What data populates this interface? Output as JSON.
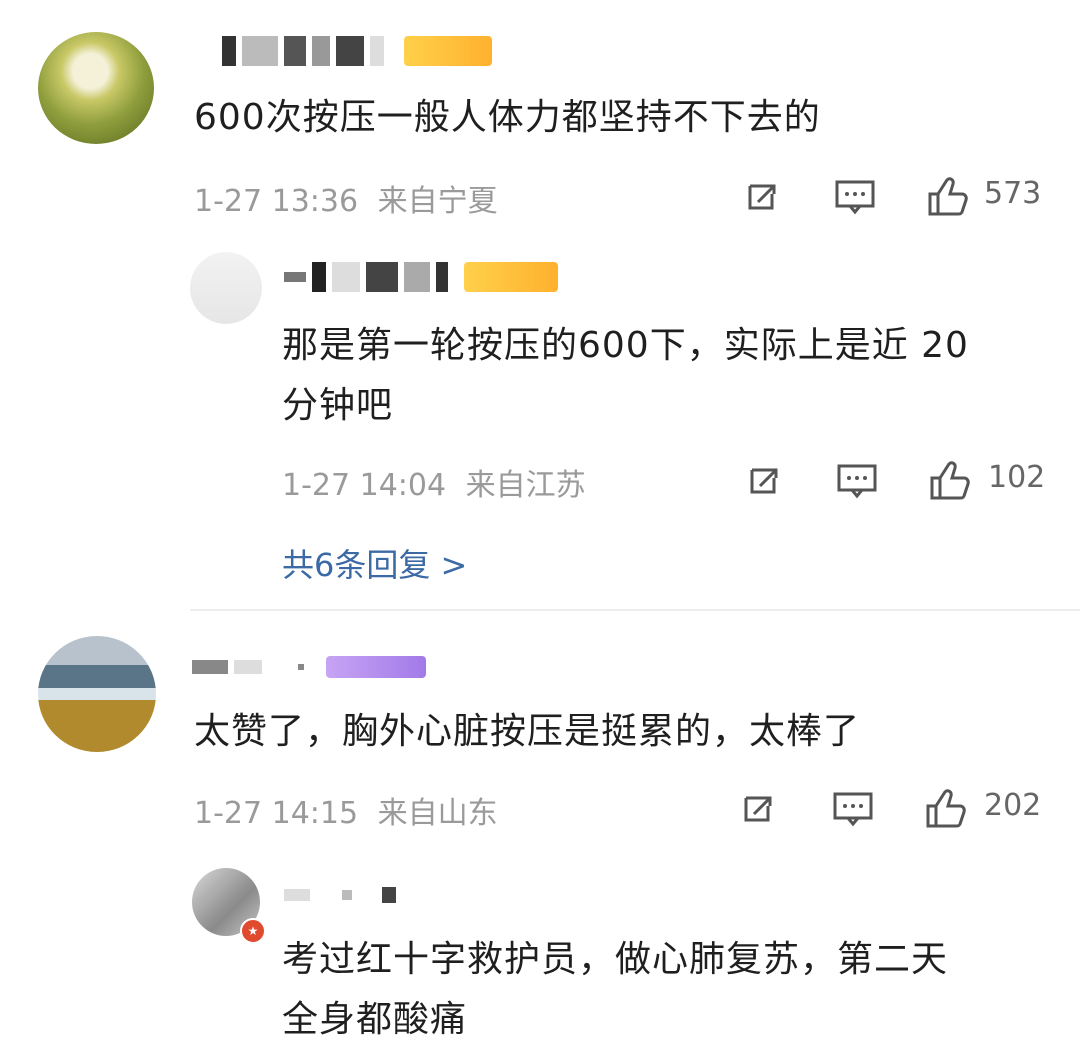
{
  "comments": [
    {
      "text": "600次按压一般人体力都坚持不下去的",
      "time": "1-27 13:36",
      "location": "来自宁夏",
      "likes": "573"
    },
    {
      "text_line1": "那是第一轮按压的600下，实际上是近 20",
      "text_line2": "分钟吧",
      "time": "1-27 14:04",
      "location": "来自江苏",
      "likes": "102"
    },
    {
      "more_replies": "共6条回复 >"
    },
    {
      "text": "太赞了，胸外心脏按压是挺累的，太棒了",
      "time": "1-27 14:15",
      "location": "来自山东",
      "likes": "202"
    },
    {
      "text_line1": "考过红十字救护员，做心肺复苏，第二天",
      "text_line2": "全身都酸痛"
    }
  ],
  "icons": {
    "share": "share-icon",
    "comment": "comment-icon",
    "like": "like-icon"
  },
  "colors": {
    "link": "#3c6aa5",
    "meta": "#9a9a9a",
    "badge": "#e04a2f"
  }
}
